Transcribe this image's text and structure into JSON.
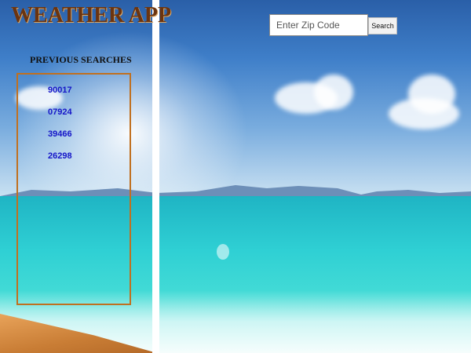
{
  "app": {
    "title": "WEATHER APP"
  },
  "history": {
    "heading": "PREVIOUS SEARCHES",
    "items": [
      "90017",
      "07924",
      "39466",
      "26298"
    ]
  },
  "search": {
    "placeholder": "Enter Zip Code",
    "value": "",
    "button_label": "Search"
  },
  "colors": {
    "title": "#6b3410",
    "history_border": "#c07020",
    "history_link": "#1515c8"
  }
}
